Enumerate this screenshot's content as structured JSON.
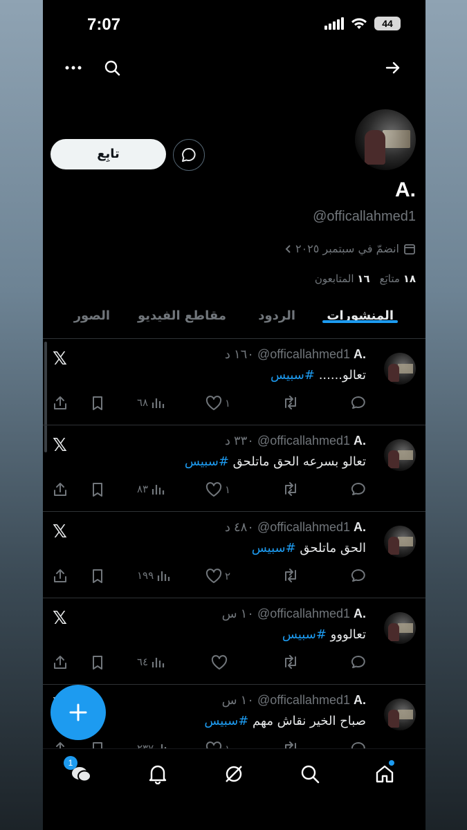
{
  "status_bar": {
    "time": "7:07",
    "battery": "44"
  },
  "profile": {
    "display_name": "A.",
    "handle": "@officallahmed1",
    "joined": "انضمّ في سبتمبر ٢٠٢٥",
    "following_count": "١٨",
    "following_label": "متابَع",
    "followers_count": "١٦",
    "followers_label": "المتابعون",
    "follow_label": "تابِع"
  },
  "tabs": [
    {
      "label": "المنشورات",
      "active": true
    },
    {
      "label": "الردود",
      "active": false
    },
    {
      "label": "مقاطع الفيديو",
      "active": false
    },
    {
      "label": "الصور",
      "active": false
    }
  ],
  "posts": [
    {
      "name": "A.",
      "handle": "@officallahmed1",
      "time": "١٦٠ د",
      "text": "تعالو......",
      "hashtag": "#سبيس",
      "likes": "١",
      "views": "٦٨"
    },
    {
      "name": "A.",
      "handle": "@officallahmed1",
      "time": "٣٣٠ د",
      "text": "تعالو بسرعه الحق ماتلحق",
      "hashtag": "#سبيس",
      "likes": "١",
      "views": "٨٣"
    },
    {
      "name": "A.",
      "handle": "@officallahmed1",
      "time": "٤٨٠ د",
      "text": "الحق ماتلحق",
      "hashtag": "#سبيس",
      "likes": "٢",
      "views": "١٩٩"
    },
    {
      "name": "A.",
      "handle": "@officallahmed1",
      "time": "١٠ س",
      "text": "تعالووو",
      "hashtag": "#سبيس",
      "likes": "",
      "views": "٦٤"
    },
    {
      "name": "A.",
      "handle": "@officallahmed1",
      "time": "١٠ س",
      "text": "صباح الخير نقاش مهم",
      "hashtag": "#سبيس",
      "likes": "١",
      "views": "٢٣٧"
    }
  ],
  "bottom_nav": {
    "messages_badge": "1"
  },
  "colors": {
    "accent": "#1d9bf0",
    "background": "#000000",
    "muted": "#71767b"
  },
  "icons": [
    "more-icon",
    "search-icon",
    "share-arrow-icon",
    "message-icon",
    "calendar-icon",
    "chevron-icon",
    "x-logo-icon",
    "reply-icon",
    "retweet-icon",
    "like-icon",
    "views-icon",
    "bookmark-icon",
    "share-icon",
    "plus-icon",
    "home-icon",
    "grok-icon",
    "bell-icon",
    "mail-icon"
  ]
}
